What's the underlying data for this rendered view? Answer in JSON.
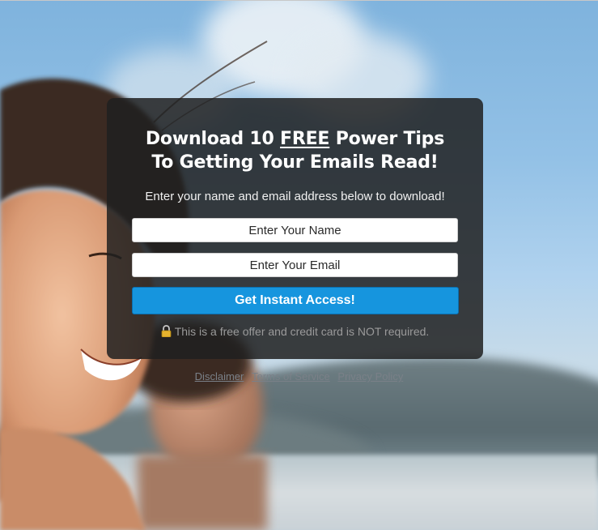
{
  "optin": {
    "headline_part1": "Download 10 ",
    "headline_free": "FREE",
    "headline_part2": " Power Tips",
    "headline_line2": "To Getting Your Emails Read!",
    "subtitle": "Enter your name and email address below to download!",
    "name_placeholder": "Enter Your Name",
    "email_placeholder": "Enter Your Email",
    "cta_label": "Get Instant Access!",
    "note": "This is a free offer and credit card is NOT required.",
    "lock_icon": "lock-icon"
  },
  "footer": {
    "links": [
      "Disclaimer",
      "Terms of Service",
      "Privacy Policy"
    ]
  },
  "colors": {
    "overlay": "#202020",
    "cta": "#1695de",
    "link": "#7a8088"
  }
}
